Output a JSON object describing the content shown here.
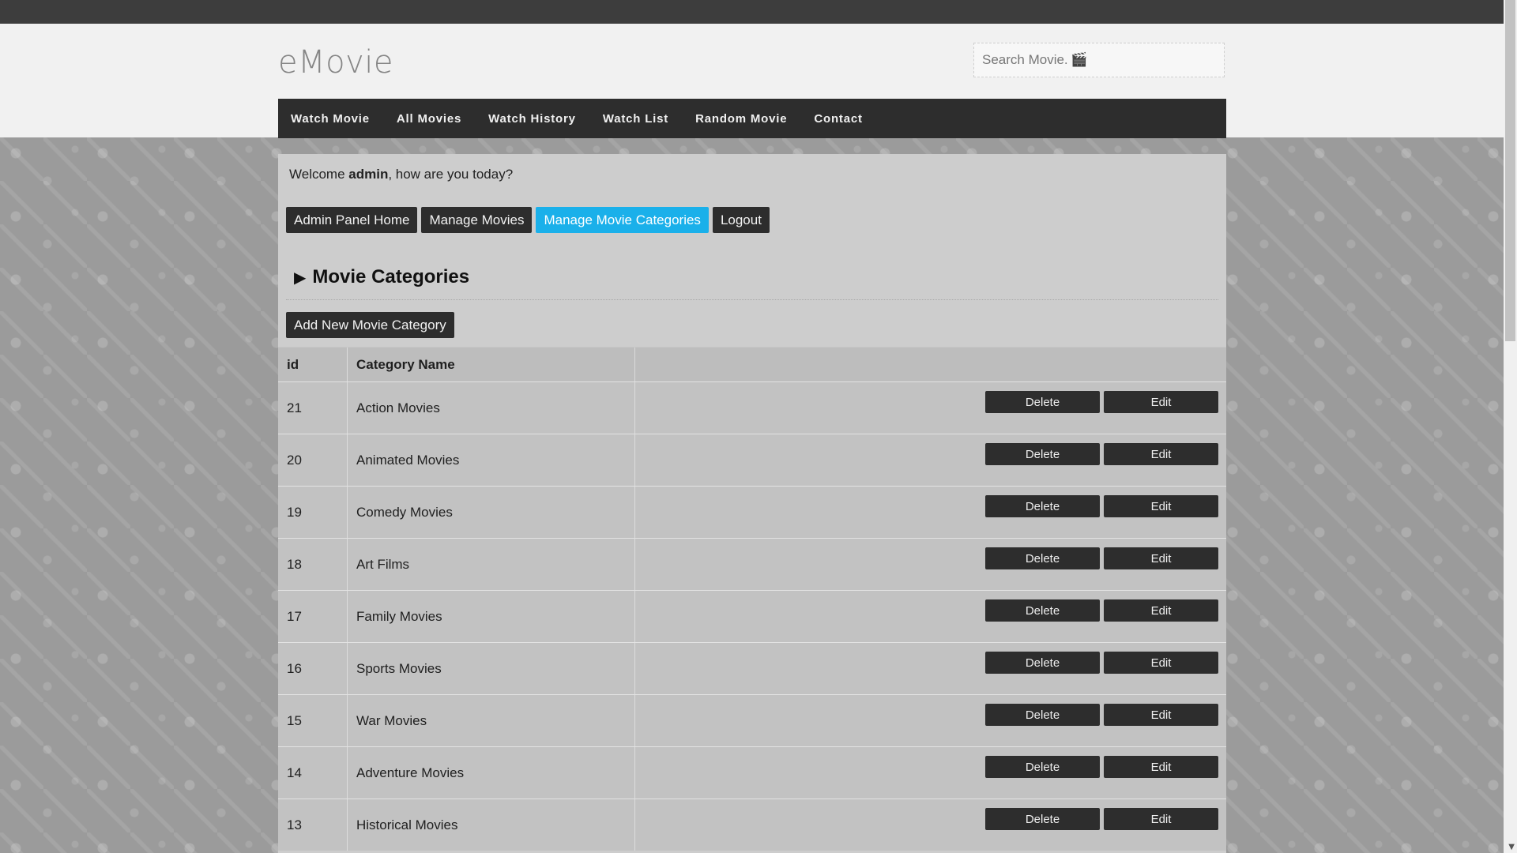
{
  "site": {
    "logo": "eMovie"
  },
  "search": {
    "placeholder": "Search Movie...",
    "icon": "clapperboard-icon"
  },
  "nav": [
    {
      "label": "Watch Movie"
    },
    {
      "label": "All Movies"
    },
    {
      "label": "Watch History"
    },
    {
      "label": "Watch List"
    },
    {
      "label": "Random Movie"
    },
    {
      "label": "Contact"
    }
  ],
  "welcome": {
    "prefix": "Welcome ",
    "user": "admin",
    "suffix": ", how are you today?"
  },
  "admin_buttons": [
    {
      "label": "Admin Panel Home"
    },
    {
      "label": "Manage Movies"
    },
    {
      "label": "Manage Movie Categories",
      "active": true
    },
    {
      "label": "Logout"
    }
  ],
  "section": {
    "title": "Movie Categories",
    "add_label": "Add New Movie Category"
  },
  "table": {
    "headers": [
      "id",
      "Category Name",
      ""
    ],
    "delete_label": "Delete",
    "edit_label": "Edit",
    "rows": [
      {
        "id": "21",
        "name": "Action Movies"
      },
      {
        "id": "20",
        "name": "Animated Movies"
      },
      {
        "id": "19",
        "name": "Comedy Movies"
      },
      {
        "id": "18",
        "name": "Art Films"
      },
      {
        "id": "17",
        "name": "Family Movies"
      },
      {
        "id": "16",
        "name": "Sports Movies"
      },
      {
        "id": "15",
        "name": "War Movies"
      },
      {
        "id": "14",
        "name": "Adventure Movies"
      },
      {
        "id": "13",
        "name": "Historical Movies"
      }
    ]
  },
  "colors": {
    "accent": "#1ab0ea",
    "dark": "#2d2d2d",
    "header_bg": "#f1f1f1"
  }
}
